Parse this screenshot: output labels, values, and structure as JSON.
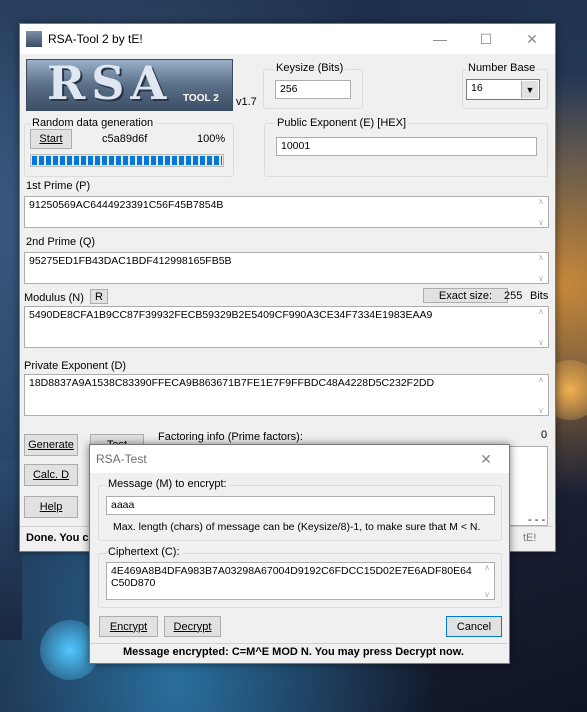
{
  "main": {
    "title": "RSA-Tool 2 by tE!",
    "version": "v1.7",
    "logo_text": "RSA",
    "logo_sub": "TOOL 2",
    "keysize": {
      "label": "Keysize (Bits)",
      "value": "256"
    },
    "number_base": {
      "label": "Number Base",
      "value": "16"
    },
    "random": {
      "label": "Random data generation",
      "start_label": "Start",
      "seed": "c5a89d6f",
      "percent": "100%",
      "progress": 1.0
    },
    "public_exponent": {
      "label": "Public Exponent (E) [HEX]",
      "value": "10001"
    },
    "prime_p": {
      "label": "1st Prime (P)",
      "value": "91250569AC6444923391C56F45B7854B"
    },
    "prime_q": {
      "label": "2nd Prime (Q)",
      "value": "95275ED1FB43DAC1BDF412998165FB5B"
    },
    "modulus": {
      "label": "Modulus (N)",
      "r_label": "R",
      "exact_size_label": "Exact size:",
      "exact_size_value": "255",
      "bits_label": "Bits",
      "value": "5490DE8CFA1B9CC87F39932FECB59329B2E5409CF990A3CE34F7334E1983EAA9"
    },
    "private_exponent": {
      "label": "Private Exponent (D)",
      "value": "18D8837A9A1538C83390FFECA9B863671B7FE1E7F9FFBDC48A4228D5C232F2DD"
    },
    "buttons": {
      "generate": "Generate",
      "test": "Test",
      "calc_d": "Calc. D",
      "help": "Help"
    },
    "factoring": {
      "label": "Factoring info (Prime factors):",
      "count": "0"
    },
    "status": "Done. You ca",
    "status_tail": "tE!",
    "dashes": "- - -"
  },
  "dialog": {
    "title": "RSA-Test",
    "message_label": "Message (M) to encrypt:",
    "message_value": "aaaa",
    "hint": "Max. length (chars) of message can be (Keysize/8)-1, to make sure that M < N.",
    "cipher_label": "Ciphertext (C):",
    "cipher_line1": "4E469A8B4DFA983B7A03298A67004D9192C6FDCC15D02E7E6ADF80E64",
    "cipher_line2": "C50D870",
    "encrypt_label": "Encrypt",
    "decrypt_label": "Decrypt",
    "cancel_label": "Cancel",
    "status": "Message encrypted: C=M^E MOD N. You may press Decrypt now."
  },
  "colors": {
    "progress": "#0078d7",
    "window_bg": "#f0f0f0",
    "accent_border": "#0078d7"
  }
}
